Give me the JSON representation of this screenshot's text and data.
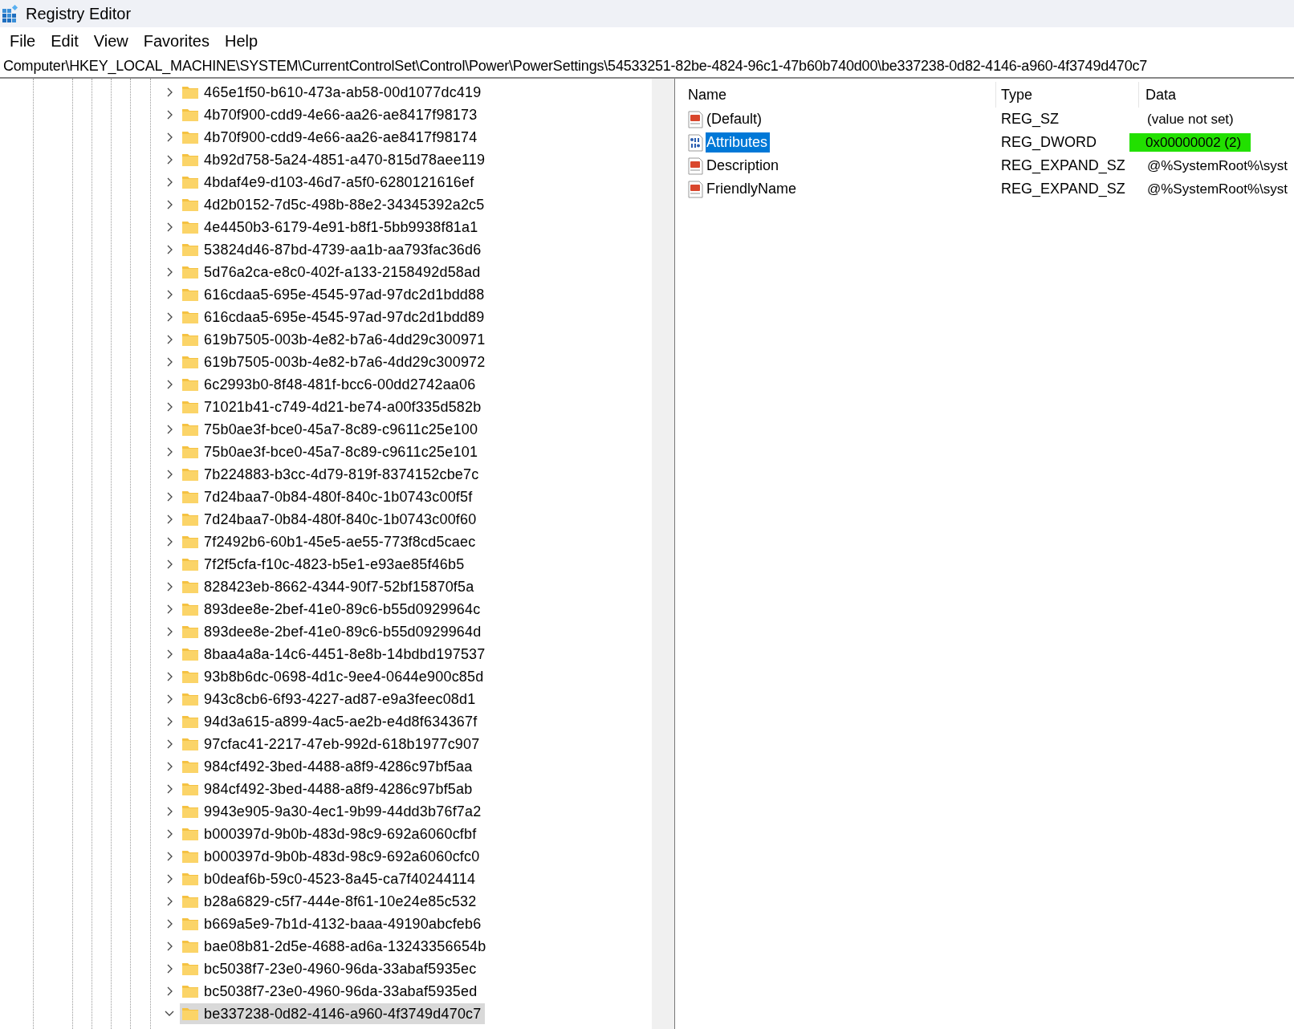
{
  "window": {
    "title": "Registry Editor"
  },
  "menu": [
    "File",
    "Edit",
    "View",
    "Favorites",
    "Help"
  ],
  "address": "Computer\\HKEY_LOCAL_MACHINE\\SYSTEM\\CurrentControlSet\\Control\\Power\\PowerSettings\\54533251-82be-4824-96c1-47b60b740d00\\be337238-0d82-4146-a960-4f3749d470c7",
  "tree": [
    {
      "label": "465e1f50-b610-473a-ab58-00d1077dc419",
      "expanded": false,
      "selected": false
    },
    {
      "label": "4b70f900-cdd9-4e66-aa26-ae8417f98173",
      "expanded": false,
      "selected": false
    },
    {
      "label": "4b70f900-cdd9-4e66-aa26-ae8417f98174",
      "expanded": false,
      "selected": false
    },
    {
      "label": "4b92d758-5a24-4851-a470-815d78aee119",
      "expanded": false,
      "selected": false
    },
    {
      "label": "4bdaf4e9-d103-46d7-a5f0-6280121616ef",
      "expanded": false,
      "selected": false
    },
    {
      "label": "4d2b0152-7d5c-498b-88e2-34345392a2c5",
      "expanded": false,
      "selected": false
    },
    {
      "label": "4e4450b3-6179-4e91-b8f1-5bb9938f81a1",
      "expanded": false,
      "selected": false
    },
    {
      "label": "53824d46-87bd-4739-aa1b-aa793fac36d6",
      "expanded": false,
      "selected": false
    },
    {
      "label": "5d76a2ca-e8c0-402f-a133-2158492d58ad",
      "expanded": false,
      "selected": false
    },
    {
      "label": "616cdaa5-695e-4545-97ad-97dc2d1bdd88",
      "expanded": false,
      "selected": false
    },
    {
      "label": "616cdaa5-695e-4545-97ad-97dc2d1bdd89",
      "expanded": false,
      "selected": false
    },
    {
      "label": "619b7505-003b-4e82-b7a6-4dd29c300971",
      "expanded": false,
      "selected": false
    },
    {
      "label": "619b7505-003b-4e82-b7a6-4dd29c300972",
      "expanded": false,
      "selected": false
    },
    {
      "label": "6c2993b0-8f48-481f-bcc6-00dd2742aa06",
      "expanded": false,
      "selected": false
    },
    {
      "label": "71021b41-c749-4d21-be74-a00f335d582b",
      "expanded": false,
      "selected": false
    },
    {
      "label": "75b0ae3f-bce0-45a7-8c89-c9611c25e100",
      "expanded": false,
      "selected": false
    },
    {
      "label": "75b0ae3f-bce0-45a7-8c89-c9611c25e101",
      "expanded": false,
      "selected": false
    },
    {
      "label": "7b224883-b3cc-4d79-819f-8374152cbe7c",
      "expanded": false,
      "selected": false
    },
    {
      "label": "7d24baa7-0b84-480f-840c-1b0743c00f5f",
      "expanded": false,
      "selected": false
    },
    {
      "label": "7d24baa7-0b84-480f-840c-1b0743c00f60",
      "expanded": false,
      "selected": false
    },
    {
      "label": "7f2492b6-60b1-45e5-ae55-773f8cd5caec",
      "expanded": false,
      "selected": false
    },
    {
      "label": "7f2f5cfa-f10c-4823-b5e1-e93ae85f46b5",
      "expanded": false,
      "selected": false
    },
    {
      "label": "828423eb-8662-4344-90f7-52bf15870f5a",
      "expanded": false,
      "selected": false
    },
    {
      "label": "893dee8e-2bef-41e0-89c6-b55d0929964c",
      "expanded": false,
      "selected": false
    },
    {
      "label": "893dee8e-2bef-41e0-89c6-b55d0929964d",
      "expanded": false,
      "selected": false
    },
    {
      "label": "8baa4a8a-14c6-4451-8e8b-14bdbd197537",
      "expanded": false,
      "selected": false
    },
    {
      "label": "93b8b6dc-0698-4d1c-9ee4-0644e900c85d",
      "expanded": false,
      "selected": false
    },
    {
      "label": "943c8cb6-6f93-4227-ad87-e9a3feec08d1",
      "expanded": false,
      "selected": false
    },
    {
      "label": "94d3a615-a899-4ac5-ae2b-e4d8f634367f",
      "expanded": false,
      "selected": false
    },
    {
      "label": "97cfac41-2217-47eb-992d-618b1977c907",
      "expanded": false,
      "selected": false
    },
    {
      "label": "984cf492-3bed-4488-a8f9-4286c97bf5aa",
      "expanded": false,
      "selected": false
    },
    {
      "label": "984cf492-3bed-4488-a8f9-4286c97bf5ab",
      "expanded": false,
      "selected": false
    },
    {
      "label": "9943e905-9a30-4ec1-9b99-44dd3b76f7a2",
      "expanded": false,
      "selected": false
    },
    {
      "label": "b000397d-9b0b-483d-98c9-692a6060cfbf",
      "expanded": false,
      "selected": false
    },
    {
      "label": "b000397d-9b0b-483d-98c9-692a6060cfc0",
      "expanded": false,
      "selected": false
    },
    {
      "label": "b0deaf6b-59c0-4523-8a45-ca7f40244114",
      "expanded": false,
      "selected": false
    },
    {
      "label": "b28a6829-c5f7-444e-8f61-10e24e85c532",
      "expanded": false,
      "selected": false
    },
    {
      "label": "b669a5e9-7b1d-4132-baaa-49190abcfeb6",
      "expanded": false,
      "selected": false
    },
    {
      "label": "bae08b81-2d5e-4688-ad6a-13243356654b",
      "expanded": false,
      "selected": false
    },
    {
      "label": "bc5038f7-23e0-4960-96da-33abaf5935ec",
      "expanded": false,
      "selected": false
    },
    {
      "label": "bc5038f7-23e0-4960-96da-33abaf5935ed",
      "expanded": false,
      "selected": false
    },
    {
      "label": "be337238-0d82-4146-a960-4f3749d470c7",
      "expanded": true,
      "selected": true
    }
  ],
  "values": {
    "columns": [
      "Name",
      "Type",
      "Data"
    ],
    "rows": [
      {
        "kind": "string",
        "name": "(Default)",
        "type": "REG_SZ",
        "data": "(value not set)",
        "selected": false,
        "highlighted": false
      },
      {
        "kind": "binary",
        "name": "Attributes",
        "type": "REG_DWORD",
        "data": "0x00000002 (2)",
        "selected": true,
        "highlighted": true
      },
      {
        "kind": "string",
        "name": "Description",
        "type": "REG_EXPAND_SZ",
        "data": "@%SystemRoot%\\syst",
        "selected": false,
        "highlighted": false
      },
      {
        "kind": "string",
        "name": "FriendlyName",
        "type": "REG_EXPAND_SZ",
        "data": "@%SystemRoot%\\syst",
        "selected": false,
        "highlighted": false
      }
    ]
  }
}
